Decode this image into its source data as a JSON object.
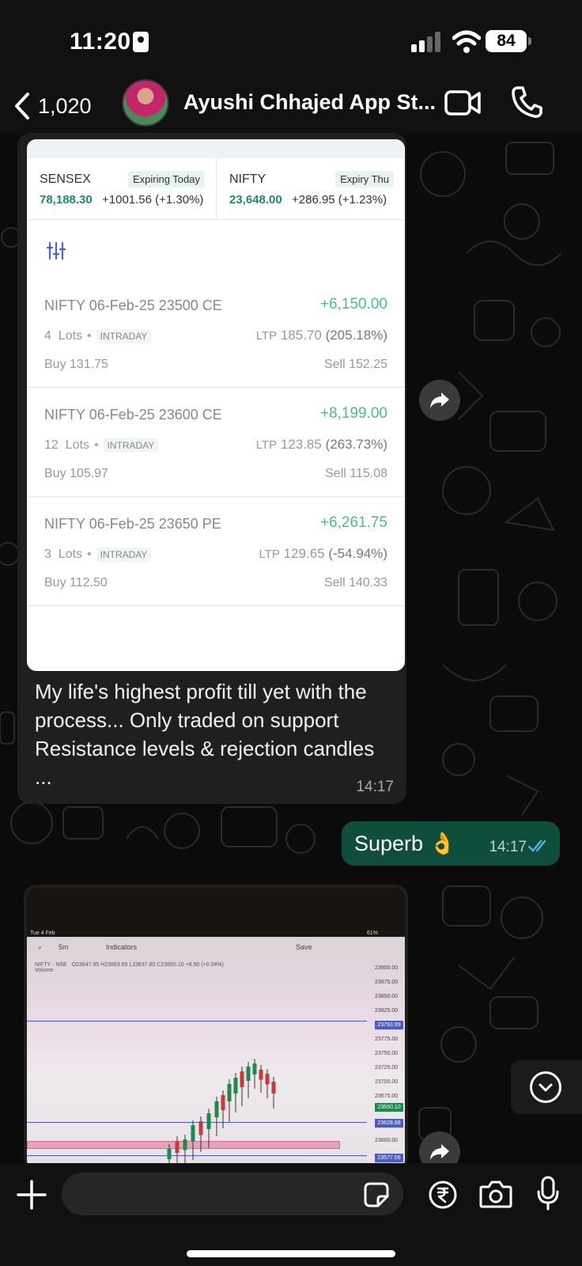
{
  "status": {
    "time": "11:20",
    "battery": "84"
  },
  "header": {
    "back_count": "1,020",
    "contact_name": "Ayushi Chhajed App St..."
  },
  "screenshot": {
    "indices": [
      {
        "name": "SENSEX",
        "tag": "Expiring Today",
        "value": "78,188.30",
        "change": "+1001.56 (+1.30%)"
      },
      {
        "name": "NIFTY",
        "tag": "Expiry Thu",
        "value": "23,648.00",
        "change": "+286.95 (+1.23%)"
      }
    ],
    "positions": [
      {
        "symbol": "NIFTY",
        "contract": "06-Feb-25 23500 CE",
        "pnl": "+6,150.00",
        "lots": "4",
        "lots_label": "Lots",
        "type": "INTRADAY",
        "ltp_label": "LTP",
        "ltp": "185.70",
        "ltp_pct": "(205.18%)",
        "buy": "Buy 131.75",
        "sell": "Sell 152.25"
      },
      {
        "symbol": "NIFTY",
        "contract": "06-Feb-25 23600 CE",
        "pnl": "+8,199.00",
        "lots": "12",
        "lots_label": "Lots",
        "type": "INTRADAY",
        "ltp_label": "LTP",
        "ltp": "123.85",
        "ltp_pct": "(263.73%)",
        "buy": "Buy 105.97",
        "sell": "Sell 115.08"
      },
      {
        "symbol": "NIFTY",
        "contract": "06-Feb-25 23650 PE",
        "pnl": "+6,261.75",
        "lots": "3",
        "lots_label": "Lots",
        "type": "INTRADAY",
        "ltp_label": "LTP",
        "ltp": "129.65",
        "ltp_pct": "(-54.94%)",
        "buy": "Buy 112.50",
        "sell": "Sell 140.33"
      }
    ]
  },
  "messages": {
    "incoming_text": "My life's highest profit till yet with the process... Only traded on support Resistance levels & rejection candles ...",
    "incoming_time": "14:17",
    "outgoing_text": "Superb 👌",
    "outgoing_time": "14:17"
  },
  "chart_image": {
    "date_label": "Tue 4 Feb",
    "tf": "5m",
    "indicators": "Indicators",
    "save": "Save",
    "battery": "61%",
    "symbol": "NIFTY · NSE",
    "ohlc": "O23647.95 H23663.65 L23637.80 C23660.10 +8.50 (+0.04%)",
    "volume": "Volume",
    "prices": [
      "23900.00",
      "23875.00",
      "23850.00",
      "23825.00",
      "23793.99",
      "23775.00",
      "23750.00",
      "23725.00",
      "23700.00",
      "23675.00",
      "23660.10",
      "23628.88",
      "23600.00",
      "23577.06"
    ]
  },
  "input": {
    "placeholder": ""
  },
  "colors": {
    "accent_green": "#4cb994",
    "bubble_out": "#0f4d3c",
    "read_ticks": "#53bdeb"
  }
}
